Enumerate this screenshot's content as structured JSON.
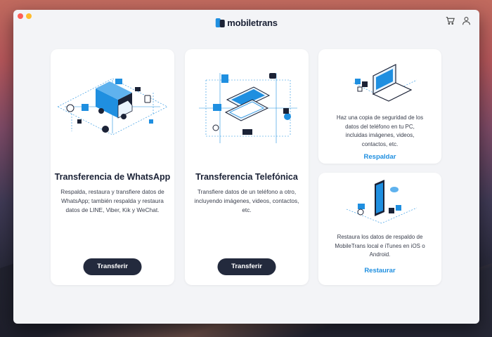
{
  "app": {
    "logo_text": "mobiletrans",
    "brand_color": "#1f8fe0",
    "dark_color": "#232a3d",
    "top_icons": [
      "cart-icon",
      "user-icon"
    ]
  },
  "cards": {
    "whatsapp": {
      "title": "Transferencia de WhatsApp",
      "desc_lines": [
        "Respalda, restaura y transfiere datos de",
        "WhatsApp; también respalda y restaura",
        "datos de LINE, Viber, Kik y WeChat."
      ],
      "button": "Transferir",
      "illustration": "truck-transfer-illustration"
    },
    "phone": {
      "title": "Transferencia Telefónica",
      "desc_lines": [
        "Transfiere datos de un teléfono a otro,",
        "incluyendo imágenes, videos, contactos, etc."
      ],
      "button": "Transferir",
      "illustration": "phone-to-phone-illustration"
    },
    "backup": {
      "desc_lines": [
        "Haz una copia de seguridad de los",
        "datos del teléfono en tu PC,",
        "incluidas imágenes, videos,",
        "contactos, etc."
      ],
      "link": "Respaldar",
      "illustration": "laptop-backup-illustration"
    },
    "restore": {
      "desc_lines": [
        "Restaura los datos de respaldo de",
        "MobileTrans local e iTunes en iOS o",
        "Android."
      ],
      "link": "Restaurar",
      "illustration": "phone-restore-illustration"
    }
  }
}
